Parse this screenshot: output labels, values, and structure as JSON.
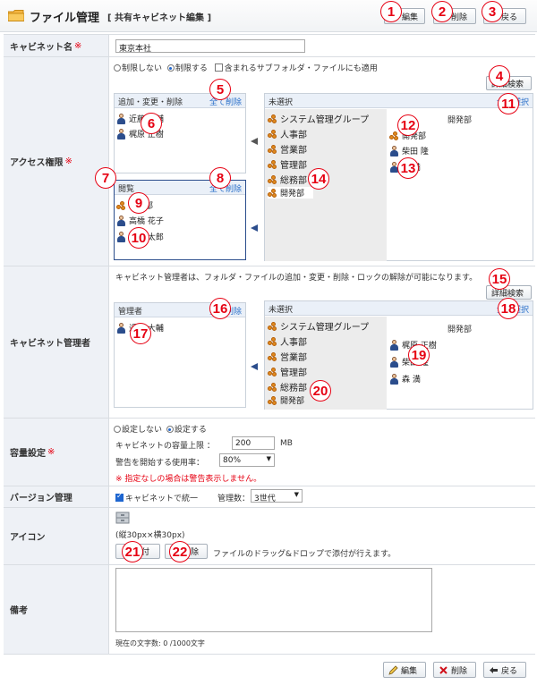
{
  "header": {
    "title": "ファイル管理",
    "subtitle": "[ 共有キャビネット編集 ]",
    "edit_label": "編集",
    "delete_label": "削除",
    "back_label": "戻る"
  },
  "cabinet_name": {
    "label": "キャビネット名",
    "required": "※",
    "value": "東京本社"
  },
  "access": {
    "label": "アクセス権限",
    "required": "※",
    "radio_none": "制限しない",
    "radio_limit": "制限する",
    "include_sub": "含まれるサブフォルダ・ファイルにも適用",
    "detail_search": "詳細検索",
    "edit_panel_title": "追加・変更・削除",
    "delete_all": "全て削除",
    "edit_users": [
      "近藤 大輔",
      "梶原 正樹"
    ],
    "view_panel_title": "閲覧",
    "view_items": [
      {
        "type": "group",
        "name": "営業部"
      },
      {
        "type": "user",
        "name": "高橋 花子"
      },
      {
        "type": "user",
        "name": "山田 太郎"
      }
    ],
    "unselected_title": "未選択",
    "select_all": "全て選択",
    "groups": [
      "システム管理グループ",
      "人事部",
      "営業部",
      "管理部",
      "総務部",
      "開発部"
    ],
    "right_header": "開発部",
    "right_items": [
      {
        "type": "group",
        "name": "開発部"
      },
      {
        "type": "user",
        "name": "柴田 隆"
      },
      {
        "type": "user",
        "name": "森 満"
      }
    ]
  },
  "managers": {
    "label": "キャビネット管理者",
    "note": "キャビネット管理者は、フォルダ・ファイルの追加・変更・削除・ロックの解除が可能になります。",
    "detail_search": "詳細検索",
    "panel_title": "管理者",
    "delete_all": "全て削除",
    "users": [
      "近藤 大輔"
    ],
    "unselected_title": "未選択",
    "select_all": "全て選択",
    "groups": [
      "システム管理グループ",
      "人事部",
      "営業部",
      "管理部",
      "総務部",
      "開発部"
    ],
    "right_header": "開発部",
    "right_users": [
      "梶原 正樹",
      "柴田 隆",
      "森 満"
    ]
  },
  "capacity": {
    "label": "容量設定",
    "required": "※",
    "radio_none": "設定しない",
    "radio_set": "設定する",
    "limit_label": "キャビネットの容量上限 ：",
    "limit_value": "200",
    "limit_unit": "MB",
    "warn_label": "警告を開始する使用率：",
    "warn_value": "80%",
    "warn_note": "※ 指定なしの場合は警告表示しません。"
  },
  "version": {
    "label": "バージョン管理",
    "unify": "キャビネットで統一",
    "count_label": "管理数：",
    "count_value": "3世代"
  },
  "icon": {
    "label": "アイコン",
    "size_note": "(縦30px×横30px)",
    "attach_label": "添付",
    "delete_label": "削除",
    "dnd_note": "ファイルのドラッグ&ドロップで添付が行えます。"
  },
  "remarks": {
    "label": "備考",
    "char_count": "現在の文字数: 0 /1000文字"
  },
  "footer": {
    "edit_label": "編集",
    "delete_label": "削除",
    "back_label": "戻る"
  },
  "badges": [
    "1",
    "2",
    "3",
    "4",
    "5",
    "6",
    "7",
    "8",
    "9",
    "10",
    "11",
    "12",
    "13",
    "14",
    "15",
    "16",
    "17",
    "18",
    "19",
    "20",
    "21",
    "22"
  ],
  "colors": {
    "label_bg": "#eef1f6",
    "link": "#2a6fc9",
    "required": "#e60012",
    "badge": "#e60012"
  }
}
